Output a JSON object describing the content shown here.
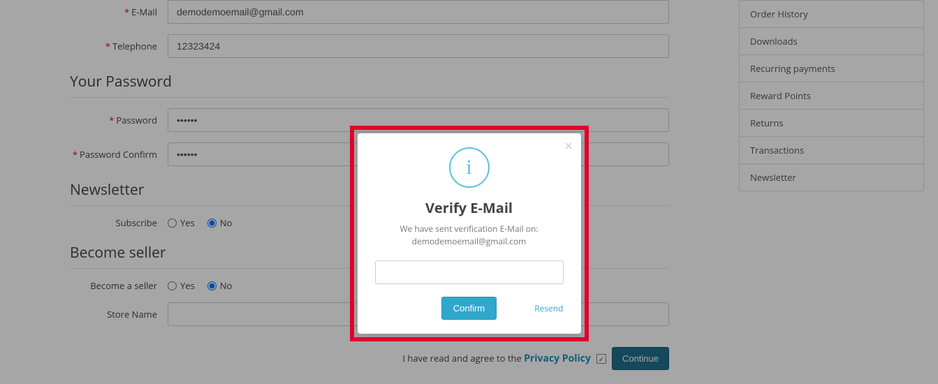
{
  "form": {
    "email_label": "E-Mail",
    "email_value": "demodemoemail@gmail.com",
    "telephone_label": "Telephone",
    "telephone_value": "12323424",
    "password_heading": "Your Password",
    "password_label": "Password",
    "password_value": "••••••",
    "password_confirm_label": "Password Confirm",
    "password_confirm_value": "••••••",
    "newsletter_heading": "Newsletter",
    "subscribe_label": "Subscribe",
    "yes_label": "Yes",
    "no_label": "No",
    "seller_heading": "Become seller",
    "become_seller_label": "Become a seller",
    "store_name_label": "Store Name",
    "store_name_value": "",
    "agreement_text": "I have read and agree to the ",
    "privacy_link": "Privacy Policy",
    "continue_label": "Continue"
  },
  "sidebar": {
    "items": [
      "Order History",
      "Downloads",
      "Recurring payments",
      "Reward Points",
      "Returns",
      "Transactions",
      "Newsletter"
    ]
  },
  "modal": {
    "title": "Verify E-Mail",
    "text_line1": "We have sent verification E-Mail on:",
    "text_line2": "demodemoemail@gmail.com",
    "confirm_label": "Confirm",
    "resend_label": "Resend"
  }
}
